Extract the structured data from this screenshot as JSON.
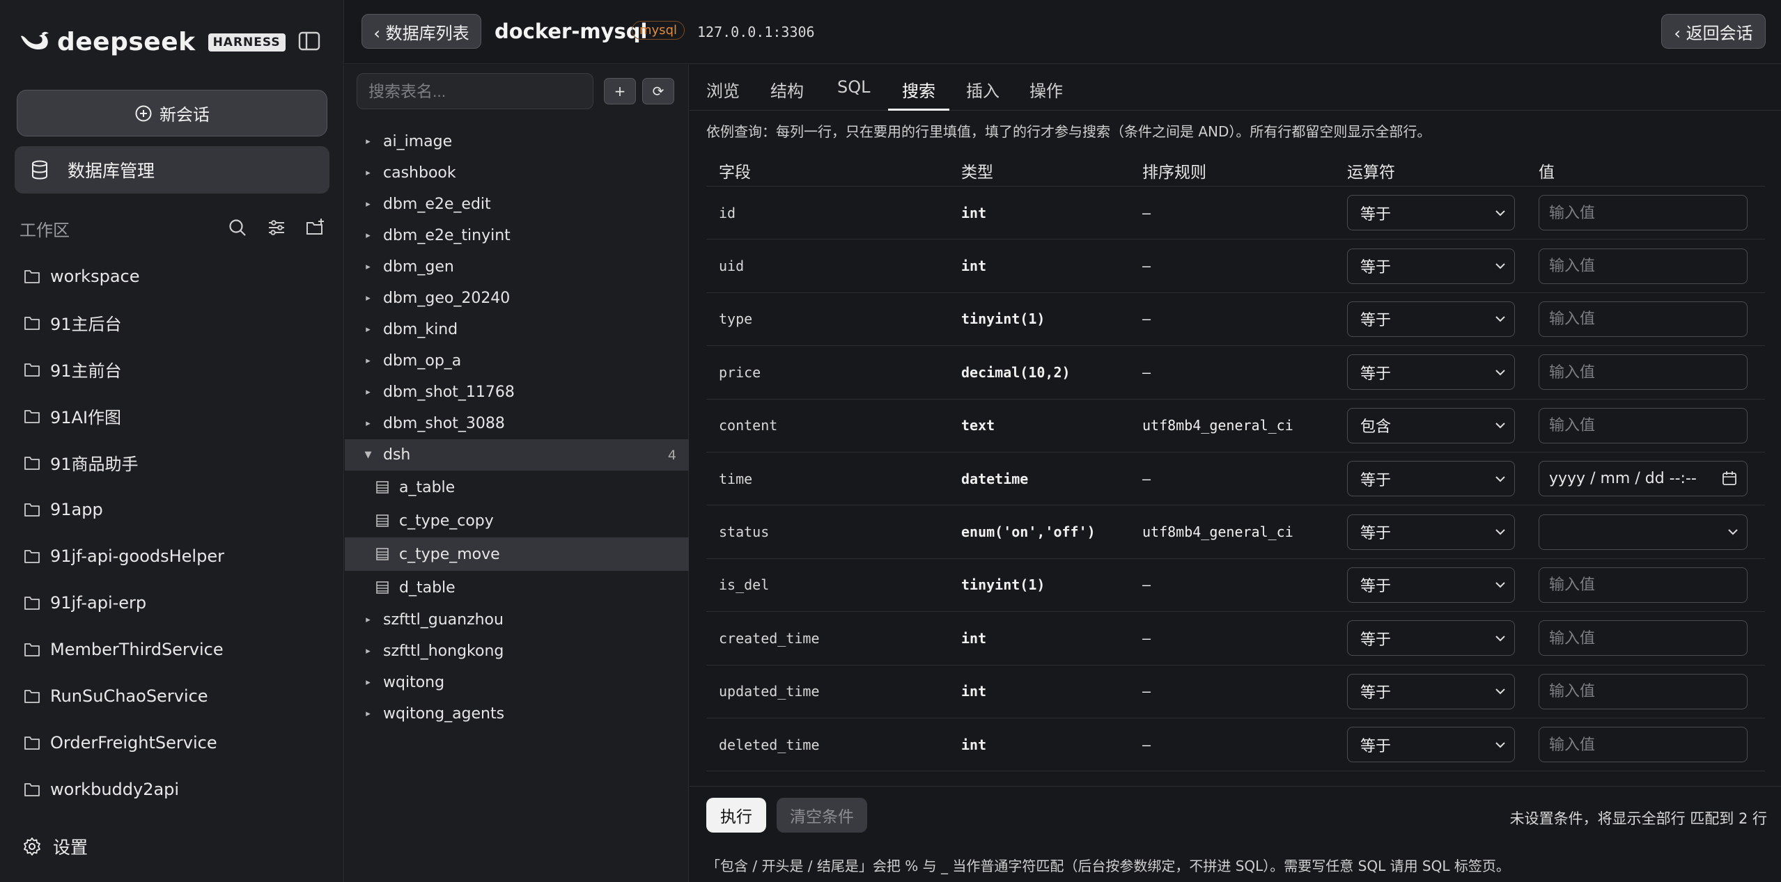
{
  "sidebar": {
    "logo_text": "deepseek",
    "logo_badge": "HARNESS",
    "new_chat_label": "新会话",
    "db_manage_label": "数据库管理",
    "workspace_title": "工作区",
    "workspaces": [
      "workspace",
      "91主后台",
      "91主前台",
      "91AI作图",
      "91商品助手",
      "91app",
      "91jf-api-goodsHelper",
      "91jf-api-erp",
      "MemberThirdService",
      "RunSuChaoService",
      "OrderFreightService",
      "workbuddy2api"
    ],
    "settings_label": "设置"
  },
  "topbar": {
    "back_list_label": "‹ 数据库列表",
    "connection_name": "docker-mysql",
    "connection_type": "mysql",
    "connection_host": "127.0.0.1:3306",
    "back_chat_label": "‹ 返回会话"
  },
  "tree": {
    "search_placeholder": "搜索表名...",
    "add_label": "+",
    "refresh_label": "⟳",
    "databases_before": [
      "ai_image",
      "cashbook",
      "dbm_e2e_edit",
      "dbm_e2e_tinyint",
      "dbm_gen",
      "dbm_geo_20240",
      "dbm_kind",
      "dbm_op_a",
      "dbm_shot_11768",
      "dbm_shot_3088"
    ],
    "open_db": {
      "name": "dsh",
      "count": "4"
    },
    "tables": [
      "a_table",
      "c_type_copy",
      "c_type_move",
      "d_table"
    ],
    "selected_table": "c_type_move",
    "databases_after": [
      "szfttl_guanzhou",
      "szfttl_hongkong",
      "wqitong",
      "wqitong_agents"
    ]
  },
  "main": {
    "tabs": [
      "浏览",
      "结构",
      "SQL",
      "搜索",
      "插入",
      "操作"
    ],
    "active_tab": "搜索",
    "hint": "依例查询：每列一行，只在要用的行里填值，填了的行才参与搜索（条件之间是 AND）。所有行都留空则显示全部行。",
    "headers": {
      "field": "字段",
      "type": "类型",
      "collation": "排序规则",
      "operator": "运算符",
      "value": "值"
    },
    "value_placeholder": "输入值",
    "date_placeholder": "yyyy / mm / dd  --:--",
    "rows": [
      {
        "field": "id",
        "type": "int",
        "collation": "–",
        "op": "等于",
        "kind": "text"
      },
      {
        "field": "uid",
        "type": "int",
        "collation": "–",
        "op": "等于",
        "kind": "text"
      },
      {
        "field": "type",
        "type": "tinyint(1)",
        "collation": "–",
        "op": "等于",
        "kind": "text"
      },
      {
        "field": "price",
        "type": "decimal(10,2)",
        "collation": "–",
        "op": "等于",
        "kind": "text"
      },
      {
        "field": "content",
        "type": "text",
        "collation": "utf8mb4_general_ci",
        "op": "包含",
        "kind": "text"
      },
      {
        "field": "time",
        "type": "datetime",
        "collation": "–",
        "op": "等于",
        "kind": "date"
      },
      {
        "field": "status",
        "type": "enum('on','off')",
        "collation": "utf8mb4_general_ci",
        "op": "等于",
        "kind": "select"
      },
      {
        "field": "is_del",
        "type": "tinyint(1)",
        "collation": "–",
        "op": "等于",
        "kind": "text"
      },
      {
        "field": "created_time",
        "type": "int",
        "collation": "–",
        "op": "等于",
        "kind": "text"
      },
      {
        "field": "updated_time",
        "type": "int",
        "collation": "–",
        "op": "等于",
        "kind": "text"
      },
      {
        "field": "deleted_time",
        "type": "int",
        "collation": "–",
        "op": "等于",
        "kind": "text"
      }
    ],
    "exec_label": "执行",
    "clear_label": "清空条件",
    "status_text": "未设置条件，将显示全部行   匹配到 2 行",
    "footnote": "「包含 / 开头是 / 结尾是」会把 % 与 _ 当作普通字符匹配（后台按参数绑定，不拼进 SQL）。需要写任意 SQL 请用 SQL 标签页。"
  }
}
